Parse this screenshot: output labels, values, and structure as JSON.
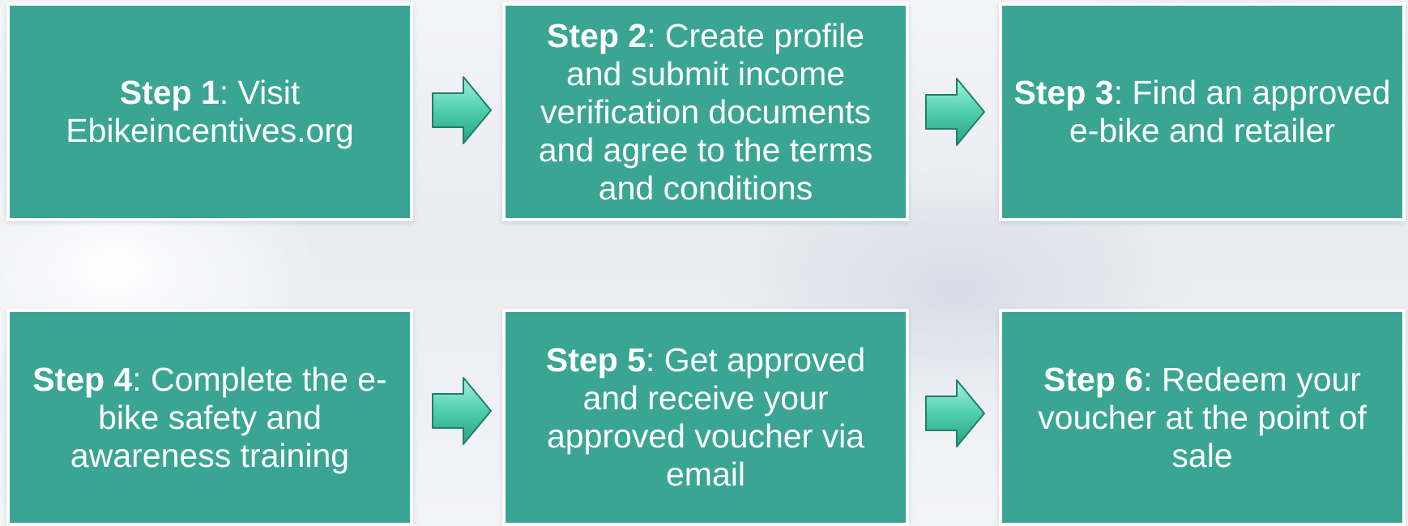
{
  "colors": {
    "box_fill": "#3aa593",
    "box_border": "#ffffff",
    "text": "#ffffff",
    "arrow_fill_light": "#8fead5",
    "arrow_fill_dark": "#2fb494",
    "arrow_stroke": "#1e7f6b"
  },
  "steps": [
    {
      "label": "Step 1",
      "text": ": Visit Ebikeincentives.org"
    },
    {
      "label": "Step 2",
      "text": ": Create profile and submit income verification documents and agree to the terms and conditions"
    },
    {
      "label": "Step 3",
      "text": ": Find an approved e-bike and retailer"
    },
    {
      "label": "Step 4",
      "text": ": Complete the e-bike safety and awareness training"
    },
    {
      "label": "Step 5",
      "text": ": Get approved and receive your approved voucher via email"
    },
    {
      "label": "Step 6",
      "text": ": Redeem your voucher at the point of sale"
    }
  ],
  "arrows": [
    {
      "icon": "right-arrow-icon"
    },
    {
      "icon": "right-arrow-icon"
    },
    {
      "icon": "right-arrow-icon"
    },
    {
      "icon": "right-arrow-icon"
    }
  ]
}
